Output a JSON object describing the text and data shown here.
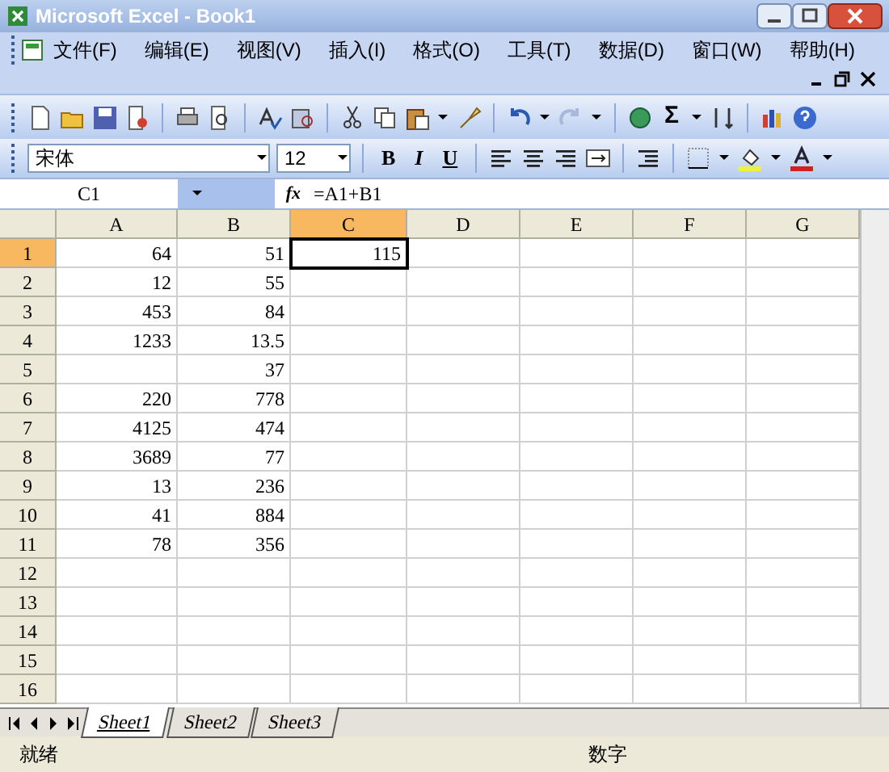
{
  "window": {
    "title": "Microsoft Excel - Book1"
  },
  "menu": [
    {
      "label": "文件(F)"
    },
    {
      "label": "编辑(E)"
    },
    {
      "label": "视图(V)"
    },
    {
      "label": "插入(I)"
    },
    {
      "label": "格式(O)"
    },
    {
      "label": "工具(T)"
    },
    {
      "label": "数据(D)"
    },
    {
      "label": "窗口(W)"
    },
    {
      "label": "帮助(H)"
    }
  ],
  "standard_toolbar": {
    "sum_symbol": "Σ"
  },
  "formatting_toolbar": {
    "font": "宋体",
    "size": "12",
    "bold": "B",
    "italic": "I",
    "underline": "U"
  },
  "formula_bar": {
    "name_box": "C1",
    "fx": "fx",
    "formula": "=A1+B1"
  },
  "columns": [
    {
      "label": "A",
      "selected": false
    },
    {
      "label": "B",
      "selected": false
    },
    {
      "label": "C",
      "selected": true
    },
    {
      "label": "D",
      "selected": false
    },
    {
      "label": "E",
      "selected": false
    },
    {
      "label": "F",
      "selected": false
    },
    {
      "label": "G",
      "selected": false
    }
  ],
  "rows": [
    {
      "label": "1",
      "selected": true,
      "cells": [
        "64",
        "51",
        "115"
      ]
    },
    {
      "label": "2",
      "selected": false,
      "cells": [
        "12",
        "55"
      ]
    },
    {
      "label": "3",
      "selected": false,
      "cells": [
        "453",
        "84"
      ]
    },
    {
      "label": "4",
      "selected": false,
      "cells": [
        "1233",
        "13.5"
      ]
    },
    {
      "label": "5",
      "selected": false,
      "cells": [
        null,
        "37"
      ]
    },
    {
      "label": "6",
      "selected": false,
      "cells": [
        "220",
        "778"
      ]
    },
    {
      "label": "7",
      "selected": false,
      "cells": [
        "4125",
        "474"
      ]
    },
    {
      "label": "8",
      "selected": false,
      "cells": [
        "3689",
        "77"
      ]
    },
    {
      "label": "9",
      "selected": false,
      "cells": [
        "13",
        "236"
      ]
    },
    {
      "label": "10",
      "selected": false,
      "cells": [
        "41",
        "884"
      ]
    },
    {
      "label": "11",
      "selected": false,
      "cells": [
        "78",
        "356"
      ]
    },
    {
      "label": "12",
      "selected": false,
      "cells": []
    },
    {
      "label": "13",
      "selected": false,
      "cells": []
    },
    {
      "label": "14",
      "selected": false,
      "cells": []
    },
    {
      "label": "15",
      "selected": false,
      "cells": []
    },
    {
      "label": "16",
      "selected": false,
      "cells": []
    }
  ],
  "sheet_tabs": [
    {
      "label": "Sheet1",
      "selected": true
    },
    {
      "label": "Sheet2",
      "selected": false
    },
    {
      "label": "Sheet3",
      "selected": false
    }
  ],
  "status_bar": {
    "left": "就绪",
    "right": "数字"
  }
}
